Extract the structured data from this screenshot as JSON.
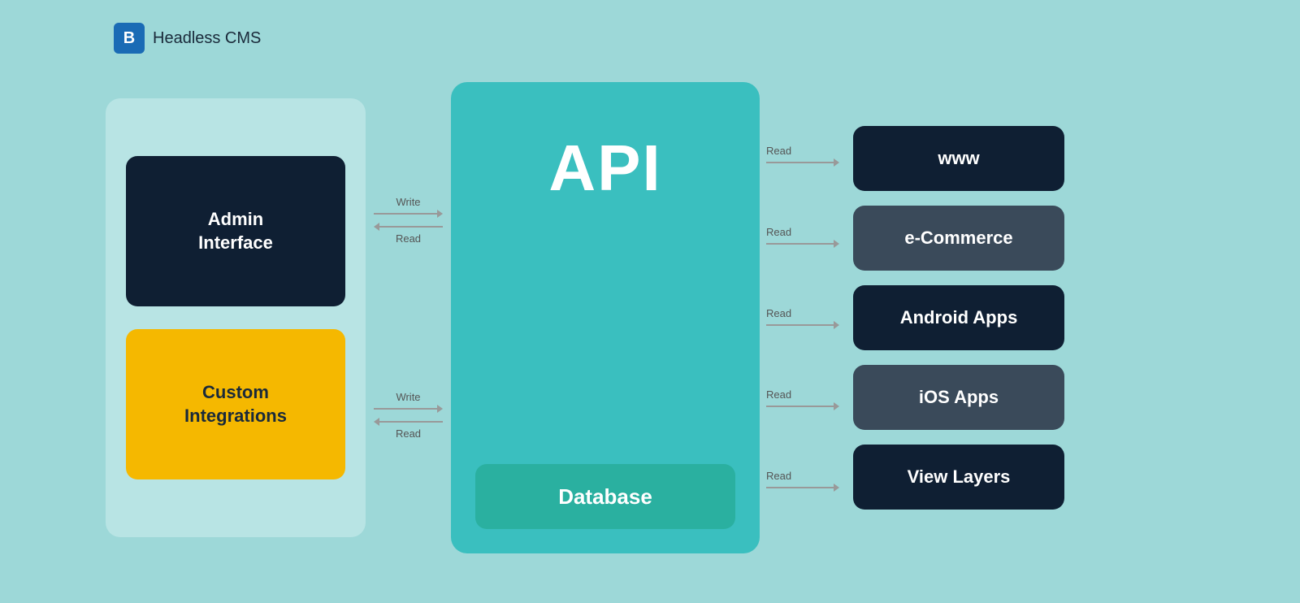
{
  "brand": {
    "icon_label": "B",
    "name": "Headless CMS"
  },
  "left_boxes": {
    "admin": {
      "label": "Admin\nInterface"
    },
    "custom": {
      "label": "Custom\nIntegrations"
    }
  },
  "arrows_left_top": {
    "write": "Write",
    "read": "Read"
  },
  "arrows_left_bottom": {
    "write": "Write",
    "read": "Read"
  },
  "api": {
    "title": "API",
    "database_label": "Database"
  },
  "right_boxes": [
    {
      "id": "www",
      "label": "www",
      "class": "output-www"
    },
    {
      "id": "ecommerce",
      "label": "e-Commerce",
      "class": "output-ecommerce"
    },
    {
      "id": "android",
      "label": "Android Apps",
      "class": "output-android"
    },
    {
      "id": "ios",
      "label": "iOS Apps",
      "class": "output-ios"
    },
    {
      "id": "view-layers",
      "label": "View Layers",
      "class": "output-view"
    }
  ],
  "read_labels": [
    "Read",
    "Read",
    "Read",
    "Read",
    "Read"
  ]
}
